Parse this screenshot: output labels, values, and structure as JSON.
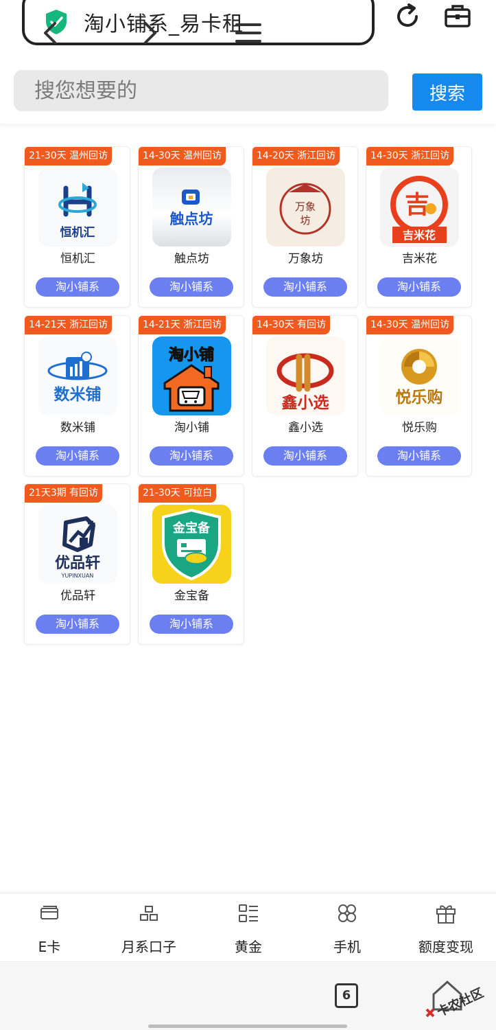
{
  "browser": {
    "url_title": "淘小铺系_易卡租",
    "icons": [
      "shield-check-icon",
      "refresh-icon",
      "toolbox-icon"
    ]
  },
  "search": {
    "placeholder": "搜您想要的",
    "button_label": "搜索"
  },
  "products": [
    {
      "tag": "21-30天 温州回访",
      "name": "恒机汇",
      "logo_text": "恒机汇",
      "button": "淘小铺系"
    },
    {
      "tag": "14-30天 温州回访",
      "name": "触点坊",
      "logo_text": "触点坊",
      "button": "淘小铺系"
    },
    {
      "tag": "14-20天 浙江回访",
      "name": "万象坊",
      "logo_text": "万象坊",
      "button": "淘小铺系"
    },
    {
      "tag": "14-30天 浙江回访",
      "name": "吉米花",
      "logo_text": "吉米花",
      "button": "淘小铺系"
    },
    {
      "tag": "14-21天 浙江回访",
      "name": "数米铺",
      "logo_text": "数米铺",
      "button": "淘小铺系"
    },
    {
      "tag": "14-21天 浙江回访",
      "name": "淘小铺",
      "logo_text": "淘小铺",
      "button": "淘小铺系"
    },
    {
      "tag": "14-30天 有回访",
      "name": "鑫小选",
      "logo_text": "鑫小选",
      "button": "淘小铺系"
    },
    {
      "tag": "14-30天 温州回访",
      "name": "悦乐购",
      "logo_text": "悦乐购",
      "button": "淘小铺系"
    },
    {
      "tag": "21天3期 有回访",
      "name": "优品轩",
      "logo_text": "优品轩",
      "logo_subtext": "YUPINXUAN",
      "button": "淘小铺系"
    },
    {
      "tag": "21-30天 可拉白",
      "name": "金宝备",
      "logo_text": "金宝备",
      "button": "淘小铺系"
    }
  ],
  "bottom_nav": [
    {
      "label": "E卡",
      "icon": "card-icon"
    },
    {
      "label": "月系口子",
      "icon": "blocks-icon"
    },
    {
      "label": "黄金",
      "icon": "list-icon"
    },
    {
      "label": "手机",
      "icon": "clover-icon"
    },
    {
      "label": "额度变现",
      "icon": "gift-icon"
    }
  ],
  "system_nav": {
    "tab_count": "6",
    "watermark": "卡农社区",
    "icons": [
      "back-icon",
      "forward-icon",
      "menu-icon",
      "tabs-icon"
    ]
  },
  "colors": {
    "accent_blue": "#1589ee",
    "tag_orange": "#f05a1e",
    "pill_button": "#6c7ff0"
  }
}
